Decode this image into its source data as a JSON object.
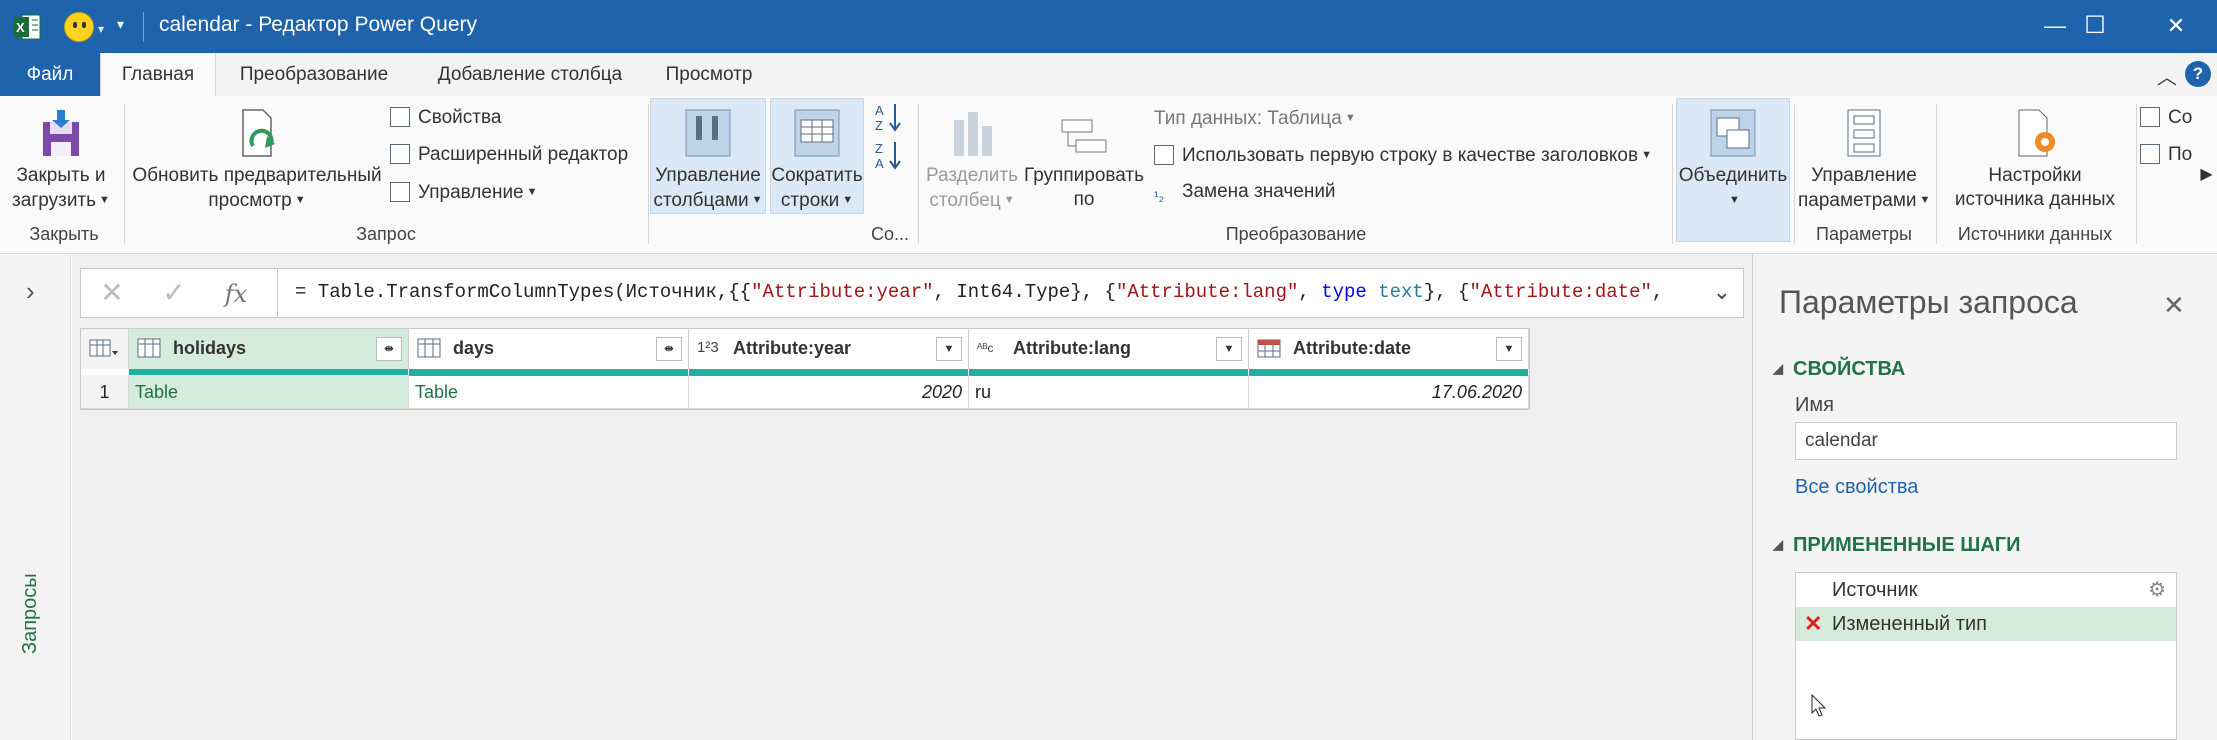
{
  "window": {
    "title": "calendar - Редактор Power Query",
    "minimize": "—",
    "maximize": "☐",
    "close": "✕"
  },
  "menu_tabs": [
    "Файл",
    "Главная",
    "Преобразование",
    "Добавление столбца",
    "Просмотр"
  ],
  "ribbon": {
    "close_load": [
      "Закрыть и",
      "загрузить"
    ],
    "close_group": "Закрыть",
    "refresh_preview": [
      "Обновить предварительный",
      "просмотр"
    ],
    "properties": "Свойства",
    "advanced_editor": "Расширенный редактор",
    "manage": "Управление",
    "query_group": "Запрос",
    "manage_columns": [
      "Управление",
      "столбцами"
    ],
    "reduce_rows": [
      "Сократить",
      "строки"
    ],
    "sort_group": "Со...",
    "split_column": [
      "Разделить",
      "столбец"
    ],
    "group_by": [
      "Группировать",
      "по"
    ],
    "data_type": "Тип данных: Таблица",
    "use_first_row": "Использовать первую строку в качестве заголовков",
    "replace_values": "Замена значений",
    "transform_group": "Преобразование",
    "combine": "Объединить",
    "manage_params": [
      "Управление",
      "параметрами"
    ],
    "params_group": "Параметры",
    "datasource_settings": [
      "Настройки",
      "источника данных"
    ],
    "datasource_group": "Источники данных",
    "overflow_1": "Со",
    "overflow_2": "По"
  },
  "queries_panel_label": "Запросы",
  "formula": {
    "prefix": "= Table.TransformColumnTypes(Источник,{{",
    "s1": "\"Attribute:year\"",
    "p2": ", Int64.Type}, {",
    "s2": "\"Attribute:lang\"",
    "p3": ", ",
    "k1": "type",
    "t1": " text",
    "p4": "}, {",
    "s3": "\"Attribute:date\"",
    "p5": ","
  },
  "grid": {
    "columns": [
      {
        "name": "holidays",
        "type_icon": "table-icon"
      },
      {
        "name": "days",
        "type_icon": "table-icon"
      },
      {
        "name": "Attribute:year",
        "type_icon": "123"
      },
      {
        "name": "Attribute:lang",
        "type_icon": "ABC"
      },
      {
        "name": "Attribute:date",
        "type_icon": "calendar-icon"
      }
    ],
    "rows": [
      {
        "index": "1",
        "holidays": "Table",
        "days": "Table",
        "year": "2020",
        "lang": "ru",
        "date": "17.06.2020"
      }
    ]
  },
  "settings": {
    "title": "Параметры запроса",
    "properties_heading": "СВОЙСТВА",
    "name_label": "Имя",
    "name_value": "calendar",
    "all_properties": "Все свойства",
    "steps_heading": "ПРИМЕНЕННЫЕ ШАГИ",
    "steps": [
      "Источник",
      "Измененный тип"
    ]
  },
  "colors": {
    "titlebar": "#1f63ad",
    "accent_green": "#217346",
    "column_quality_bar": "#20b2a0",
    "selected_step": "#d5ebdc"
  }
}
